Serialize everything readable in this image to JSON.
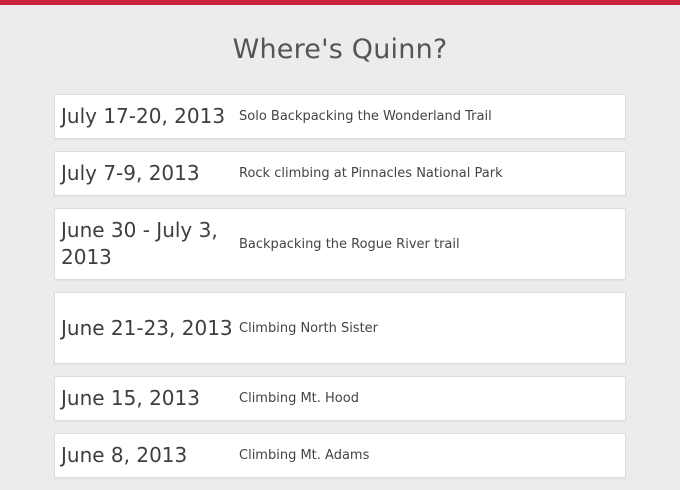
{
  "page": {
    "title": "Where's Quinn?"
  },
  "colors": {
    "accent_bar": "#c8233b",
    "background": "#ececec",
    "card": "#ffffff"
  },
  "trips": [
    {
      "date": "July 17-20, 2013",
      "description": "Solo Backpacking the Wonderland Trail"
    },
    {
      "date": "July 7-9, 2013",
      "description": "Rock climbing at Pinnacles National Park"
    },
    {
      "date": "June 30 - July 3, 2013",
      "description": "Backpacking the Rogue River trail"
    },
    {
      "date": "June 21-23, 2013",
      "description": "Climbing North Sister"
    },
    {
      "date": "June 15, 2013",
      "description": "Climbing Mt. Hood"
    },
    {
      "date": "June 8, 2013",
      "description": "Climbing Mt. Adams"
    }
  ]
}
